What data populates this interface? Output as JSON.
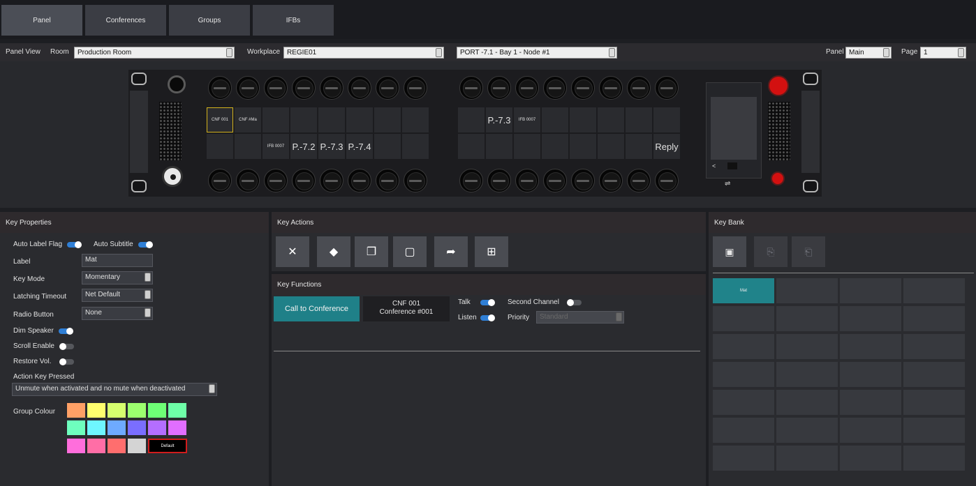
{
  "nav": {
    "tabs": [
      "Panel",
      "Conferences",
      "Groups",
      "IFBs"
    ],
    "active": 0
  },
  "viewbar": {
    "panel_view_label": "Panel View",
    "room_label": "Room",
    "room_value": "Production Room",
    "workplace_label": "Workplace",
    "workplace_value": "REGIE01",
    "port_value": "PORT -7.1 - Bay 1 - Node #1",
    "panel_label": "Panel",
    "panel_value": "Main",
    "page_label": "Page",
    "page_value": "1"
  },
  "device": {
    "left_keys": [
      "CNF 001",
      "CNF #Ma",
      "",
      "",
      "",
      "",
      "",
      "",
      "",
      "",
      "IFB 0007",
      "P.-7.2",
      "P.-7.3",
      "P.-7.4",
      "",
      ""
    ],
    "right_keys": [
      "",
      "P.-7.3",
      "IFB 0007",
      "",
      "",
      "",
      "",
      "",
      "",
      "",
      "",
      "",
      "",
      "",
      "",
      "Reply"
    ],
    "screen_back": "<",
    "usb_icon": "⇌"
  },
  "key_properties": {
    "title": "Key Properties",
    "auto_label_flag": "Auto Label Flag",
    "auto_subtitle": "Auto Subtitle",
    "label_label": "Label",
    "label_value": "Mat",
    "key_mode_label": "Key Mode",
    "key_mode_value": "Momentary",
    "latching_timeout_label": "Latching Timeout",
    "latching_timeout_value": "Net Default",
    "radio_button_label": "Radio Button",
    "radio_button_value": "None",
    "dim_speaker": "Dim Speaker",
    "scroll_enable": "Scroll Enable",
    "restore_vol": "Restore Vol.",
    "action_key_pressed": "Action Key Pressed",
    "action_value": "Unmute when activated and no mute when deactivated",
    "group_colour": "Group Colour",
    "default_label": "Default",
    "colours": [
      "#ffa066",
      "#ffff6e",
      "#d6ff6e",
      "#9cff6e",
      "#6eff76",
      "#6effa8",
      "#6effbe",
      "#6ef6ff",
      "#6eaaff",
      "#7a6eff",
      "#b46eff",
      "#e16eff",
      "#ff6edc",
      "#ff6ea6",
      "#ff6e6e",
      "#d4d4d4"
    ]
  },
  "key_actions": {
    "title": "Key Actions",
    "buttons": [
      "tools-icon",
      "eraser-icon",
      "copy-icon",
      "clipboard-icon",
      "forward-icon",
      "add-icon"
    ]
  },
  "key_functions": {
    "title": "Key Functions",
    "call_button": "Call to Conference",
    "conf_name": "CNF 001",
    "conf_sub": "Conference #001",
    "talk": "Talk",
    "listen": "Listen",
    "second_channel": "Second Channel",
    "priority": "Priority",
    "priority_value": "Standard"
  },
  "key_bank": {
    "title": "Key Bank",
    "active_cell": "Mat"
  }
}
